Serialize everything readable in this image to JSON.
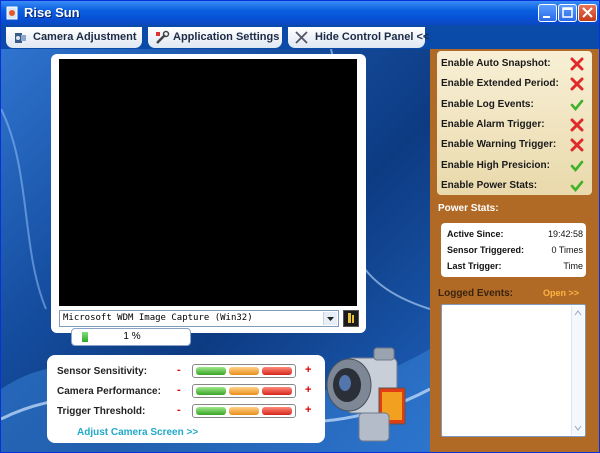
{
  "window": {
    "title": "Rise Sun",
    "app_icon": "rise-sun-app-icon"
  },
  "titlebar_buttons": [
    "minimize",
    "maximize",
    "close"
  ],
  "toolbar": {
    "camera_adjustment": "Camera Adjustment",
    "application_settings": "Application Settings",
    "hide_control_panel": "Hide Control Panel <<"
  },
  "video": {
    "device": "Microsoft WDM Image Capture (Win32)",
    "progress_text": "1 %",
    "progress_value": 0.01
  },
  "controls": {
    "sensor_sensitivity": "Sensor Sensitivity:",
    "camera_performance": "Camera Performance:",
    "trigger_threshold": "Trigger Threshold:",
    "minus": "-",
    "plus": "+",
    "adjust_link": "Adjust Camera Screen >>"
  },
  "options": [
    {
      "label": "Enable Auto Snapshot:",
      "enabled": false
    },
    {
      "label": "Enable Extended Period:",
      "enabled": false
    },
    {
      "label": "Enable Log Events:",
      "enabled": true
    },
    {
      "label": "Enable Alarm Trigger:",
      "enabled": false
    },
    {
      "label": "Enable Warning Trigger:",
      "enabled": false
    },
    {
      "label": "Enable High Presicion:",
      "enabled": true
    },
    {
      "label": "Enable Power Stats:",
      "enabled": true
    }
  ],
  "power_stats": {
    "heading": "Power Stats:",
    "active_since_label": "Active Since:",
    "active_since_value": "19:42:58",
    "sensor_triggered_label": "Sensor Triggered:",
    "sensor_triggered_value": "0 Times",
    "last_trigger_label": "Last Trigger:",
    "last_trigger_value": "Time"
  },
  "logged_events": {
    "heading": "Logged Events:",
    "open_link": "Open >>"
  },
  "colors": {
    "titlebar": "#0a5fe0",
    "side_panel": "#b06a26",
    "accent_link": "#1fa9c9",
    "open_link": "#ffb340"
  }
}
